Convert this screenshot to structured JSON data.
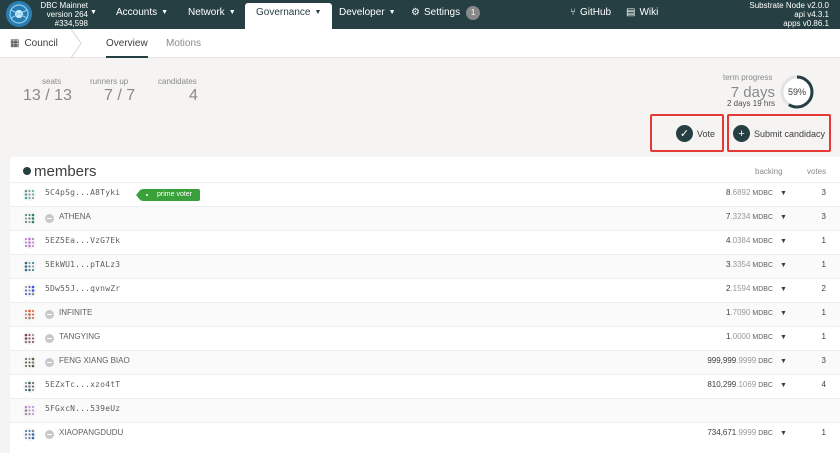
{
  "top": {
    "chain_name": "DBC Mainnet",
    "version": "version 264",
    "block": "#334,598",
    "nav": [
      {
        "label": "Accounts"
      },
      {
        "label": "Network"
      },
      {
        "label": "Governance"
      },
      {
        "label": "Developer"
      },
      {
        "label": "Settings",
        "badge": "1"
      },
      {
        "label": "GitHub"
      },
      {
        "label": "Wiki"
      }
    ],
    "node": [
      "Substrate Node v2.0.0",
      "api v4.3.1",
      "apps v0.86.1"
    ]
  },
  "sub": {
    "section": "Council",
    "tabs": [
      "Overview",
      "Motions"
    ]
  },
  "summary": {
    "seats": {
      "label": "seats",
      "value": "13 / 13"
    },
    "runners": {
      "label": "runners up",
      "value": "7 / 7"
    },
    "candidates": {
      "label": "candidates",
      "value": "4"
    },
    "term": {
      "label": "term progress",
      "days": "7 days",
      "remaining": "2 days 19 hrs",
      "percent": "59%",
      "fraction": 0.59
    }
  },
  "actions": {
    "vote": "Vote",
    "submit": "Submit candidacy"
  },
  "table": {
    "title": "members",
    "col_backing": "backing",
    "col_votes": "votes",
    "rows": [
      {
        "id": "5C4pSg...A8Tyki",
        "named": false,
        "tag": "prime voter",
        "whole": "8",
        "frac": ".6892",
        "unit": "MDBC",
        "votes": "3",
        "color": "#4aa8a0"
      },
      {
        "id": "ATHENA",
        "named": true,
        "whole": "7",
        "frac": ".3234",
        "unit": "MDBC",
        "votes": "3",
        "color": "#2e7d6e"
      },
      {
        "id": "5EZ5Ea...VzG7Ek",
        "named": false,
        "whole": "4",
        "frac": ".0384",
        "unit": "MDBC",
        "votes": "1",
        "color": "#c678d9"
      },
      {
        "id": "5EkWU1...pTALz3",
        "named": false,
        "whole": "3",
        "frac": ".3354",
        "unit": "MDBC",
        "votes": "1",
        "color": "#2b6f8a"
      },
      {
        "id": "5Dw55J...qvnwZr",
        "named": false,
        "whole": "2",
        "frac": ".1594",
        "unit": "MDBC",
        "votes": "2",
        "color": "#3f51d8"
      },
      {
        "id": "INFINITE",
        "named": true,
        "whole": "1",
        "frac": ".7090",
        "unit": "MDBC",
        "votes": "1",
        "color": "#e0583a"
      },
      {
        "id": "TANGYING",
        "named": true,
        "whole": "1",
        "frac": ".0000",
        "unit": "MDBC",
        "votes": "1",
        "color": "#8a3a5c"
      },
      {
        "id": "FENG XIANG BIAO",
        "named": true,
        "whole": "999,999",
        "frac": ".9999",
        "unit": "DBC",
        "votes": "3",
        "color": "#5a5a3a"
      },
      {
        "id": "5EZxTc...xzo4tT",
        "named": false,
        "whole": "810,299",
        "frac": ".1069",
        "unit": "DBC",
        "votes": "4",
        "color": "#3a5f6a"
      },
      {
        "id": "5FGxcN...539eUz",
        "named": false,
        "whole": "",
        "frac": "",
        "unit": "",
        "votes": "",
        "color": "#b78ad6"
      },
      {
        "id": "XIAOPANGDUDU",
        "named": true,
        "whole": "734,671",
        "frac": ".9999",
        "unit": "DBC",
        "votes": "1",
        "color": "#3a6fa8"
      }
    ]
  }
}
